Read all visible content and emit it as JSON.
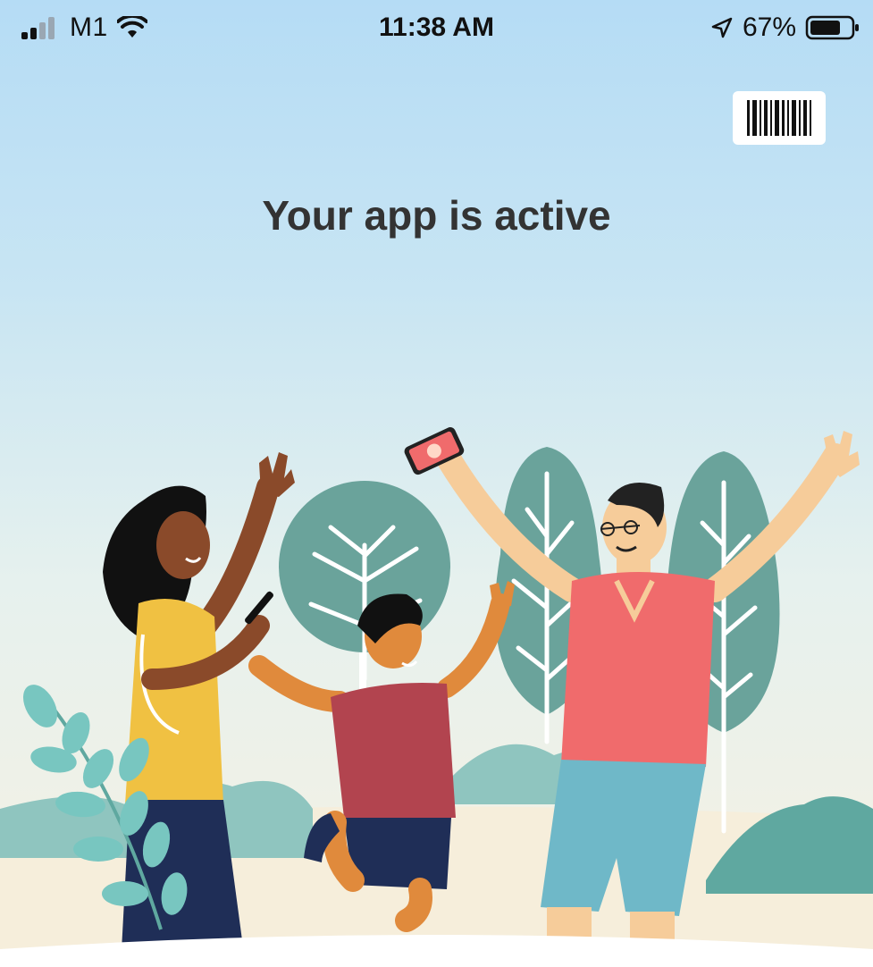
{
  "status_bar": {
    "carrier": "M1",
    "time": "11:38 AM",
    "battery_percent": "67%",
    "signal_icon": "signal-bars-icon",
    "wifi_icon": "wifi-icon",
    "location_icon": "location-arrow-icon",
    "battery_icon": "battery-icon"
  },
  "header": {
    "barcode_button_icon": "barcode-icon"
  },
  "main": {
    "headline": "Your app is active",
    "illustration": "celebrating-family-illustration"
  },
  "colors": {
    "sky_top": "#b5dcf5",
    "ground": "#f6f1e2",
    "tree": "#6aa39b",
    "shirt_yellow": "#f0c142",
    "shirt_red": "#b2444f",
    "shirt_coral": "#f06b6c",
    "shorts_blue": "#6fb8c8",
    "pants_navy": "#1f2e57"
  }
}
